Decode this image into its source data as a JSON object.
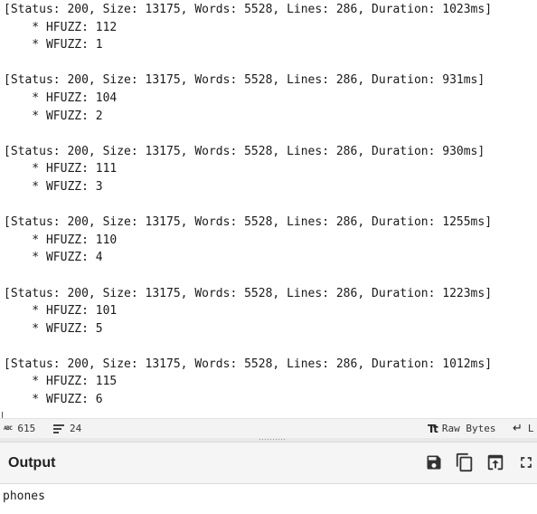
{
  "input": {
    "blocks": [
      {
        "status_line": "[Status: 200, Size: 13175, Words: 5528, Lines: 286, Duration: 1023ms]",
        "hfuzz": "    * HFUZZ: 112",
        "wfuzz": "    * WFUZZ: 1"
      },
      {
        "status_line": "[Status: 200, Size: 13175, Words: 5528, Lines: 286, Duration: 931ms]",
        "hfuzz": "    * HFUZZ: 104",
        "wfuzz": "    * WFUZZ: 2"
      },
      {
        "status_line": "[Status: 200, Size: 13175, Words: 5528, Lines: 286, Duration: 930ms]",
        "hfuzz": "    * HFUZZ: 111",
        "wfuzz": "    * WFUZZ: 3"
      },
      {
        "status_line": "[Status: 200, Size: 13175, Words: 5528, Lines: 286, Duration: 1255ms]",
        "hfuzz": "    * HFUZZ: 110",
        "wfuzz": "    * WFUZZ: 4"
      },
      {
        "status_line": "[Status: 200, Size: 13175, Words: 5528, Lines: 286, Duration: 1223ms]",
        "hfuzz": "    * HFUZZ: 101",
        "wfuzz": "    * WFUZZ: 5"
      },
      {
        "status_line": "[Status: 200, Size: 13175, Words: 5528, Lines: 286, Duration: 1012ms]",
        "hfuzz": "    * HFUZZ: 115",
        "wfuzz": "    * WFUZZ: 6"
      }
    ]
  },
  "input_status": {
    "chars_icon": "ABC",
    "chars_count": "615",
    "lines_count": "24",
    "encoding_icon": "Tt",
    "encoding_label": "Raw Bytes",
    "eol_icon": "↵",
    "eol_label": "L"
  },
  "output": {
    "title": "Output",
    "text": "phones"
  },
  "icons": {
    "save": "save-icon",
    "copy": "copy-icon",
    "replace_input": "replace-input-icon",
    "maximize": "maximize-icon"
  }
}
